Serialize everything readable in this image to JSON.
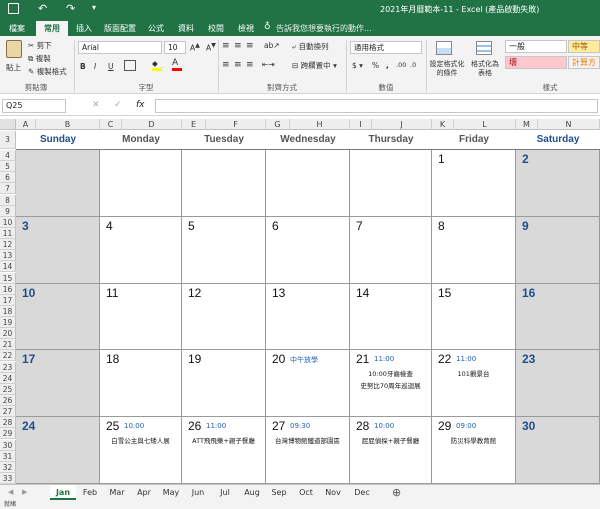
{
  "window": {
    "title": "2021年月曆範本-11 - Excel (產品啟動失敗)"
  },
  "ribbon_tabs": [
    "檔案",
    "常用",
    "插入",
    "版面配置",
    "公式",
    "資料",
    "校閱",
    "檢視"
  ],
  "tell_me": "告訴我您想要執行的動作...",
  "clipboard": {
    "paste": "貼上",
    "cut": "剪下",
    "copy": "複製",
    "format_painter": "複製格式",
    "group": "剪貼簿"
  },
  "font": {
    "name": "Arial",
    "size": "10",
    "group": "字型"
  },
  "alignment": {
    "wrap": "自動換列",
    "merge": "跨欄置中",
    "group": "對齊方式"
  },
  "number": {
    "format": "通用格式",
    "group": "數值"
  },
  "styles": {
    "conditional": "設定格式化的條件",
    "table": "格式化為表格",
    "normal": "一般",
    "neutral": "中等",
    "bad": "壞",
    "calc": "計算方",
    "group": "樣式",
    "colors": {
      "normal_bg": "#ffffff",
      "neutral_bg": "#ffeb9c",
      "bad_bg": "#ffc7ce",
      "calc_bg": "#f2f2f2"
    }
  },
  "namebox": "Q25",
  "fx": "fx",
  "columns": [
    "A",
    "B",
    "C",
    "D",
    "E",
    "F",
    "G",
    "H",
    "I",
    "J",
    "K",
    "L",
    "M",
    "N"
  ],
  "rows": {
    "r3": "3",
    "r4": "4",
    "r5": "5",
    "r6": "6",
    "r7": "7",
    "r8": "8",
    "r9": "9",
    "r10": "10",
    "r11": "11",
    "r12": "12",
    "r13": "13",
    "r14": "14",
    "r15": "15",
    "r16": "16",
    "r17": "17",
    "r18": "18",
    "r19": "19",
    "r20": "20",
    "r21": "21",
    "r22": "22",
    "r23": "23",
    "r24": "24",
    "r25": "25",
    "r26": "26",
    "r27": "27",
    "r28": "28",
    "r29": "29",
    "r30": "30",
    "r31": "31",
    "r32": "32",
    "r33": "33"
  },
  "days": [
    "Sunday",
    "Monday",
    "Tuesday",
    "Wednesday",
    "Thursday",
    "Friday",
    "Saturday"
  ],
  "weeks": [
    [
      {
        "n": ""
      },
      {
        "n": ""
      },
      {
        "n": ""
      },
      {
        "n": ""
      },
      {
        "n": ""
      },
      {
        "n": "1"
      },
      {
        "n": "2"
      }
    ],
    [
      {
        "n": "3"
      },
      {
        "n": "4"
      },
      {
        "n": "5"
      },
      {
        "n": "6"
      },
      {
        "n": "7"
      },
      {
        "n": "8"
      },
      {
        "n": "9"
      }
    ],
    [
      {
        "n": "10"
      },
      {
        "n": "11"
      },
      {
        "n": "12"
      },
      {
        "n": "13"
      },
      {
        "n": "14"
      },
      {
        "n": "15"
      },
      {
        "n": "16"
      }
    ],
    [
      {
        "n": "17"
      },
      {
        "n": "18"
      },
      {
        "n": "19"
      },
      {
        "n": "20",
        "tag": "中午放學"
      },
      {
        "n": "21",
        "tag": "11:00",
        "l1": "10:00牙齒檢查",
        "l2": "史努比70周年巡迴展"
      },
      {
        "n": "22",
        "tag": "11:00",
        "l1": "101觀景台"
      },
      {
        "n": "23"
      }
    ],
    [
      {
        "n": "24"
      },
      {
        "n": "25",
        "tag": "10:00",
        "l1": "白雪公主與七矮人展"
      },
      {
        "n": "26",
        "tag": "11:00",
        "l1": "ATT飛飛樂+親子餐廳"
      },
      {
        "n": "27",
        "tag": "09:30",
        "l1": "台灣博物館鐵道部園區"
      },
      {
        "n": "28",
        "tag": "10:00",
        "l1": "屁屁偵探+親子餐廳"
      },
      {
        "n": "29",
        "tag": "09:00",
        "l1": "防災科學教育館"
      },
      {
        "n": "30"
      }
    ]
  ],
  "sheets": [
    "Jan",
    "Feb",
    "Mar",
    "Apr",
    "May",
    "Jun",
    "Jul",
    "Aug",
    "Sep",
    "Oct",
    "Nov",
    "Dec"
  ],
  "add_sheet": "⊕",
  "status": "就緒"
}
